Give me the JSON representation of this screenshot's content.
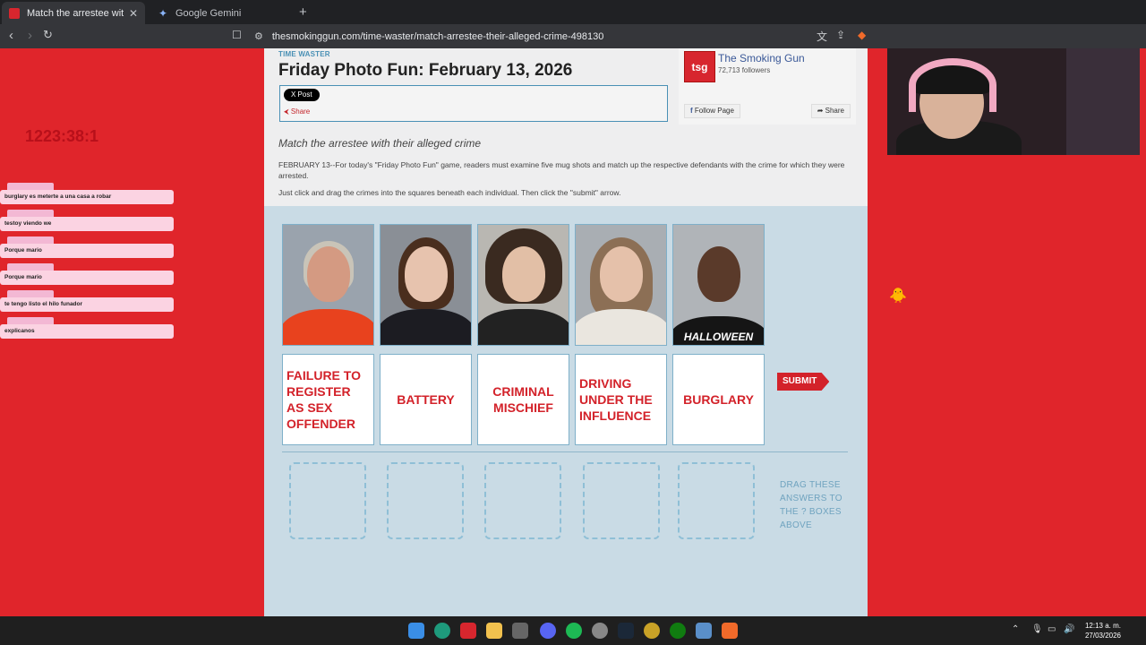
{
  "browser": {
    "tabs": [
      {
        "title": "Match the arrestee with their alleged crime",
        "active": true
      },
      {
        "title": "Google Gemini",
        "active": false
      }
    ],
    "url": "thesmokinggun.com/time-waster/match-arrestee-their-alleged-crime-498130"
  },
  "article": {
    "section": "TIME WASTER",
    "title": "Friday Photo Fun: February 13, 2026",
    "post_label": "X Post",
    "share_label": "Share",
    "subtitle": "Match the arrestee with their alleged crime",
    "intro": "FEBRUARY 13--For today's \"Friday Photo Fun\" game, readers must examine five mug shots and match up the respective defendants with the crime for which they were arrested.",
    "instructions": "Just click and drag the crimes into the squares beneath each individual. Then click the \"submit\" arrow."
  },
  "facebook": {
    "logo": "tsg",
    "name": "The Smoking Gun",
    "followers": "72,713 followers",
    "follow_label": "Follow Page",
    "share_label": "Share"
  },
  "game": {
    "crimes": [
      "FAILURE TO REGISTER AS SEX OFFENDER",
      "BATTERY",
      "CRIMINAL MISCHIEF",
      "DRIVING UNDER THE INFLUENCE",
      "BURGLARY"
    ],
    "submit_label": "SUBMIT",
    "drag_hint": "DRAG THESE ANSWERS TO THE ? BOXES ABOVE",
    "shirt_text": "HALLOWEEN"
  },
  "overlay": {
    "timer": "1223:38:1",
    "chat": [
      "burglary es meterte a una casa a robar",
      "testoy viendo we",
      "Porque mario",
      "Porque mario",
      "te tengo listo el hilo funador",
      "explicanos"
    ]
  },
  "system": {
    "time": "12:13 a. m.",
    "date": "27/03/2026"
  }
}
